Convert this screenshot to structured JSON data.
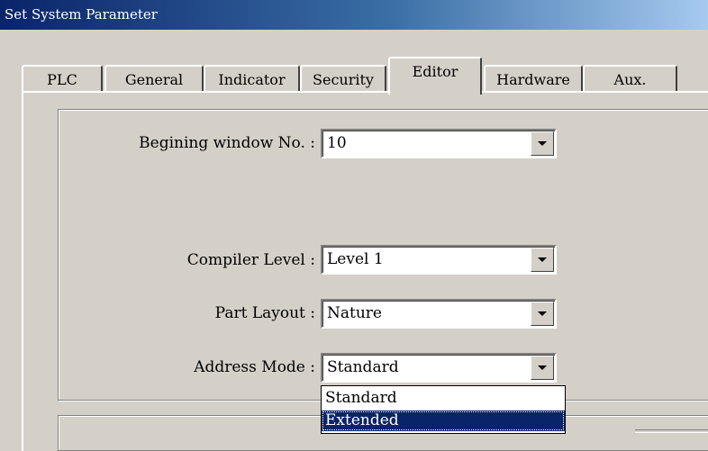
{
  "window": {
    "title": "Set System Parameter"
  },
  "tabs": [
    {
      "label": "PLC",
      "active": false
    },
    {
      "label": "General",
      "active": false
    },
    {
      "label": "Indicator",
      "active": false
    },
    {
      "label": "Security",
      "active": false
    },
    {
      "label": "Editor",
      "active": true
    },
    {
      "label": "Hardware",
      "active": false
    },
    {
      "label": "Aux.",
      "active": false
    }
  ],
  "editor": {
    "begin_window": {
      "label": "Begining window No. :",
      "value": "10"
    },
    "compiler_level": {
      "label": "Compiler Level :",
      "value": "Level 1"
    },
    "part_layout": {
      "label": "Part Layout :",
      "value": "Nature"
    },
    "address_mode": {
      "label": "Address Mode :",
      "value": "Standard",
      "options": [
        "Standard",
        "Extended"
      ],
      "highlighted": "Extended"
    }
  },
  "colors": {
    "title_bar": "#0a246a",
    "dialog_face": "#d4d0c8",
    "selection": "#0a246a"
  },
  "icons": {
    "dropdown": "chevron-down-icon"
  }
}
